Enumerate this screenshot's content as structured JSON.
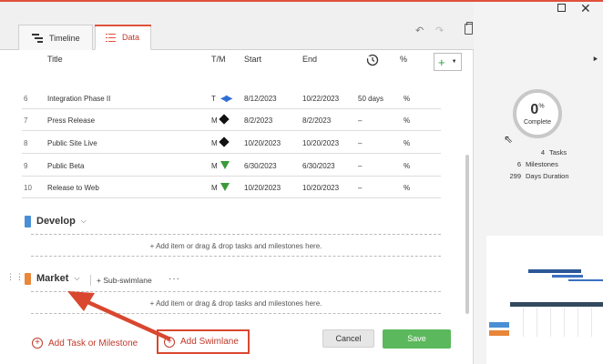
{
  "tabs": [
    {
      "label": "Timeline"
    },
    {
      "label": "Data"
    }
  ],
  "columns": {
    "title": "Title",
    "tm": "T/M",
    "start": "Start",
    "end": "End",
    "percent": "%"
  },
  "rows": [
    {
      "num": "6",
      "title": "Integration Phase II",
      "tm": "T",
      "start": "8/12/2023",
      "end": "10/22/2023",
      "duration": "50 days",
      "percent": "%"
    },
    {
      "num": "7",
      "title": "Press Release",
      "tm": "M",
      "start": "8/2/2023",
      "end": "8/2/2023",
      "duration": "–",
      "percent": "%"
    },
    {
      "num": "8",
      "title": "Public Site Live",
      "tm": "M",
      "start": "10/20/2023",
      "end": "10/20/2023",
      "duration": "–",
      "percent": "%"
    },
    {
      "num": "9",
      "title": "Public Beta",
      "tm": "M",
      "start": "6/30/2023",
      "end": "6/30/2023",
      "duration": "–",
      "percent": "%"
    },
    {
      "num": "10",
      "title": "Release to Web",
      "tm": "M",
      "start": "10/20/2023",
      "end": "10/20/2023",
      "duration": "–",
      "percent": "%"
    }
  ],
  "swimlanes": [
    {
      "name": "Develop",
      "color": "#4a8fd6",
      "drop_hint": "+ Add item or drag & drop tasks and milestones here."
    },
    {
      "name": "Market",
      "color": "#e8863a",
      "drop_hint": "+ Add item or drag & drop tasks and milestones here."
    }
  ],
  "subswimlane_label": "+ Sub-swimlane",
  "more_label": "···",
  "footer": {
    "add_task": "Add Task or Milestone",
    "add_swimlane": "Add Swimlane",
    "cancel": "Cancel",
    "save": "Save"
  },
  "summary": {
    "complete_value": "0",
    "complete_unit": "%",
    "complete_label": "Complete",
    "tasks_count": "4",
    "tasks_label": "Tasks",
    "milestones_count": "6",
    "milestones_label": "Milestones",
    "duration_count": "299",
    "duration_label": "Days Duration"
  },
  "colors": {
    "accent": "#e0513d",
    "save": "#5cb85c",
    "milestone_green": "#3a9a3a",
    "task_blue": "#2f6fd6"
  },
  "icons": [
    "timeline-icon",
    "data-list-icon",
    "undo-icon",
    "redo-icon",
    "clipboard-icon",
    "duration-clock-icon",
    "plus-icon",
    "chevron-down-icon",
    "drag-grip-icon",
    "plus-circle-icon",
    "expand-right-icon",
    "maximize-icon",
    "close-icon"
  ]
}
